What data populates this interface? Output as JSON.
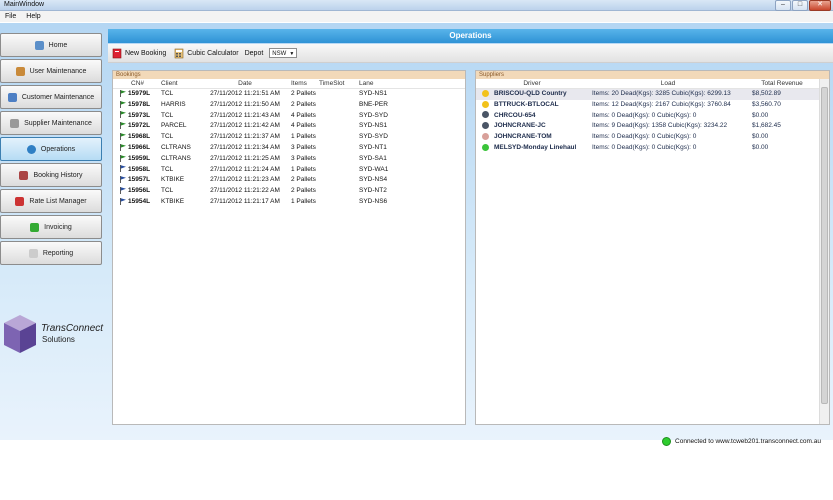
{
  "window": {
    "title": "MainWindow"
  },
  "menu": [
    "File",
    "Help"
  ],
  "nav": [
    {
      "label": "Home",
      "icon": "home-icon"
    },
    {
      "label": "User Maintenance",
      "icon": "users-icon"
    },
    {
      "label": "Customer Maintenance",
      "icon": "customer-icon"
    },
    {
      "label": "Supplier Maintenance",
      "icon": "supplier-icon"
    },
    {
      "label": "Operations",
      "icon": "globe-icon",
      "active": true
    },
    {
      "label": "Booking History",
      "icon": "history-icon"
    },
    {
      "label": "Rate List Manager",
      "icon": "rate-list-icon"
    },
    {
      "label": "Invoicing",
      "icon": "invoice-icon"
    },
    {
      "label": "Reporting",
      "icon": "report-icon"
    }
  ],
  "logo": {
    "line1": "TransConnect",
    "line2": "Solutions"
  },
  "header": {
    "title": "Operations"
  },
  "toolbar": {
    "new_booking": "New Booking",
    "cubic_calculator": "Cubic Calculator",
    "depot_label": "Depot",
    "depot_value": "NSW"
  },
  "bookings": {
    "title": "Bookings",
    "columns": [
      "CN#",
      "Client",
      "Date",
      "Items",
      "TimeSlot",
      "Lane"
    ],
    "rows": [
      {
        "cn": "15979L",
        "client": "TCL",
        "date": "27/11/2012 11:21:51 AM",
        "items": "2  Pallets",
        "timeslot": "",
        "lane": "SYD-NS1",
        "flag": "green"
      },
      {
        "cn": "15978L",
        "client": "HARRIS",
        "date": "27/11/2012 11:21:50 AM",
        "items": "2  Pallets",
        "timeslot": "",
        "lane": "BNE-PER",
        "flag": "green"
      },
      {
        "cn": "15973L",
        "client": "TCL",
        "date": "27/11/2012 11:21:43 AM",
        "items": "4  Pallets",
        "timeslot": "",
        "lane": "SYD-SYD",
        "flag": "green"
      },
      {
        "cn": "15972L",
        "client": "PARCEL",
        "date": "27/11/2012 11:21:42 AM",
        "items": "4  Pallets",
        "timeslot": "",
        "lane": "SYD-NS1",
        "flag": "green"
      },
      {
        "cn": "15968L",
        "client": "TCL",
        "date": "27/11/2012 11:21:37 AM",
        "items": "1  Pallets",
        "timeslot": "",
        "lane": "SYD-SYD",
        "flag": "green"
      },
      {
        "cn": "15966L",
        "client": "CLTRANS",
        "date": "27/11/2012 11:21:34 AM",
        "items": "3  Pallets",
        "timeslot": "",
        "lane": "SYD-NT1",
        "flag": "green"
      },
      {
        "cn": "15959L",
        "client": "CLTRANS",
        "date": "27/11/2012 11:21:25 AM",
        "items": "3  Pallets",
        "timeslot": "",
        "lane": "SYD-SA1",
        "flag": "green"
      },
      {
        "cn": "15958L",
        "client": "TCL",
        "date": "27/11/2012 11:21:24 AM",
        "items": "1  Pallets",
        "timeslot": "",
        "lane": "SYD-WA1",
        "flag": "blue"
      },
      {
        "cn": "15957L",
        "client": "KTBIKE",
        "date": "27/11/2012 11:21:23 AM",
        "items": "2  Pallets",
        "timeslot": "",
        "lane": "SYD-NS4",
        "flag": "blue"
      },
      {
        "cn": "15956L",
        "client": "TCL",
        "date": "27/11/2012 11:21:22 AM",
        "items": "2  Pallets",
        "timeslot": "",
        "lane": "SYD-NT2",
        "flag": "blue"
      },
      {
        "cn": "15954L",
        "client": "KTBIKE",
        "date": "27/11/2012 11:21:17 AM",
        "items": "1  Pallets",
        "timeslot": "",
        "lane": "SYD-NS6",
        "flag": "blue"
      }
    ]
  },
  "suppliers": {
    "title": "Suppliers",
    "columns": [
      "Driver",
      "Load",
      "Total Revenue"
    ],
    "rows": [
      {
        "driver": "BRISCOU-QLD Country",
        "load": "Items: 20 Dead(Kgs): 3285 Cubic(Kgs): 6299.13",
        "revenue": "$8,502.89",
        "status": "yellow"
      },
      {
        "driver": "BTTRUCK-BTLOCAL",
        "load": "Items: 12 Dead(Kgs): 2167 Cubic(Kgs): 3760.84",
        "revenue": "$3,560.70",
        "status": "yellow"
      },
      {
        "driver": "CHRCOU-654",
        "load": "Items: 0 Dead(Kgs): 0 Cubic(Kgs): 0",
        "revenue": "$0.00",
        "status": "grey"
      },
      {
        "driver": "JOHNCRANE-JC",
        "load": "Items: 9 Dead(Kgs): 1358 Cubic(Kgs): 3234.22",
        "revenue": "$1,682.45",
        "status": "grey"
      },
      {
        "driver": "JOHNCRANE-TOM",
        "load": "Items: 0 Dead(Kgs): 0 Cubic(Kgs): 0",
        "revenue": "$0.00",
        "status": "red"
      },
      {
        "driver": "MELSYD-Monday Linehaul",
        "load": "Items: 0 Dead(Kgs): 0 Cubic(Kgs): 0",
        "revenue": "$0.00",
        "status": "green"
      }
    ]
  },
  "status": {
    "connection": "Connected to www.tcweb201.transconnect.com.au"
  },
  "colors": {
    "accent": "#3aa0e0",
    "panel_header": "#f2d9b9"
  }
}
